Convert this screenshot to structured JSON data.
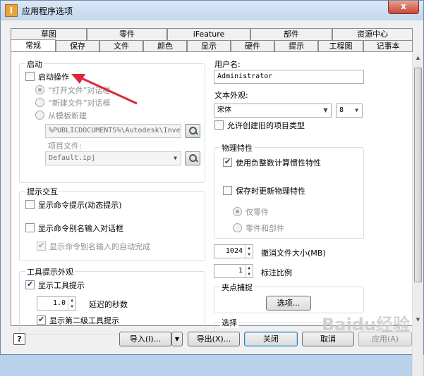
{
  "window": {
    "title": "应用程序选项",
    "app_icon_letter": "I",
    "close_label": "x"
  },
  "tabs_back": [
    "草图",
    "零件",
    "iFeature",
    "部件",
    "资源中心"
  ],
  "tabs_front": [
    "常规",
    "保存",
    "文件",
    "颜色",
    "显示",
    "硬件",
    "提示",
    "工程图",
    "记事本"
  ],
  "startup": {
    "group_title": "启动",
    "startup_action_label": "启动操作",
    "startup_action_checked": false,
    "open_file_dialog": "“打开文件”对话框",
    "new_file_dialog": "“新建文件”对话框",
    "from_template": "从模板新建",
    "template_path": "%PUBLICDOCUMENTS%\\Autodesk\\Inven",
    "project_file_label": "项目文件:",
    "project_file_value": "Default.ipj"
  },
  "prompts": {
    "group_title": "提示交互",
    "show_command_prompt": "显示命令提示(动态提示)",
    "show_alias_dialog": "显示命令别名输入对话框",
    "show_alias_autocomplete": "显示命令别名输入的自动完成"
  },
  "tooltips": {
    "group_title": "工具提示外观",
    "show_tooltips": "显示工具提示",
    "delay_value": "1.0",
    "delay_label": "延迟的秒数",
    "show_second_level": "显示第二级工具提示"
  },
  "user": {
    "username_label": "用户名:",
    "username_value": "Administrator",
    "text_style_label": "文本外观:",
    "font_value": "宋体",
    "font_size_value": "8",
    "allow_legacy_label": "允许创建旧的项目类型"
  },
  "physical": {
    "group_title": "物理特性",
    "use_negative_label": "使用负整数计算惯性特性",
    "update_on_save_label": "保存时更新物理特性",
    "parts_only": "仅零件",
    "parts_and_assemblies": "零件和部件"
  },
  "undo": {
    "value": "1024",
    "label": "撤消文件大小(MB)"
  },
  "annotation": {
    "value": "1",
    "label": "标注比例"
  },
  "grips": {
    "group_title": "夹点捕捉",
    "options_button": "选项..."
  },
  "selection": {
    "group_title": "选择"
  },
  "buttons": {
    "help": "?",
    "import": "导入(I)...",
    "export": "导出(X)...",
    "close": "关闭",
    "cancel": "取消",
    "apply": "应用(A)"
  },
  "watermark": "Baidu经验",
  "colors": {
    "annotation_arrow": "#e0263a",
    "title_gradient_top": "#dbe8f6",
    "close_button": "#c74a3a"
  }
}
